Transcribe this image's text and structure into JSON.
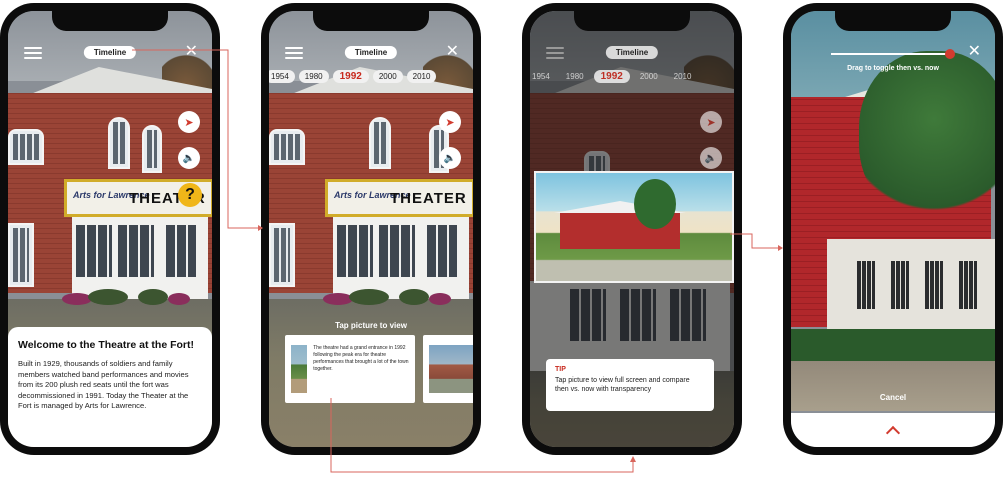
{
  "phone1": {
    "timeline_label": "Timeline",
    "canopy_sign_left": "Arts for Lawrence",
    "canopy_sign_right": "THEATER",
    "info_title": "Welcome to the Theatre at the Fort!",
    "info_body": "Built in 1929, thousands of soldiers and family members watched band performances and movies from its 200 plush red seats until the fort was decommissioned in 1991. Today the Theater at the Fort is managed by Arts for Lawrence.",
    "help_glyph": "?"
  },
  "phone2": {
    "timeline_label": "Timeline",
    "years": [
      "1954",
      "1980",
      "1992",
      "2000",
      "2010"
    ],
    "active_year": "1992",
    "canopy_sign_left": "Arts for Lawrence",
    "canopy_sign_right": "THEATER",
    "tap_label": "Tap picture to view",
    "card_text": "The theatre had a grand entrance in 1992 following the peak era for theatre performances that brought a lot of the town together."
  },
  "phone3": {
    "timeline_label": "Timeline",
    "years": [
      "1954",
      "1980",
      "1992",
      "2000",
      "2010"
    ],
    "active_year": "1992",
    "tip_heading": "TIP",
    "tip_body": "Tap picture to view full screen and compare then vs. now with transparency"
  },
  "phone4": {
    "drag_label": "Drag to toggle then vs. now",
    "cancel_label": "Cancel"
  },
  "colors": {
    "accent": "#d23b2f",
    "help": "#f0b619",
    "phone_frame": "#0c0c0c"
  },
  "icons": [
    "menu-icon",
    "close-icon",
    "navigation-arrow-icon",
    "speaker-icon",
    "help-icon",
    "chevron-up-icon"
  ]
}
